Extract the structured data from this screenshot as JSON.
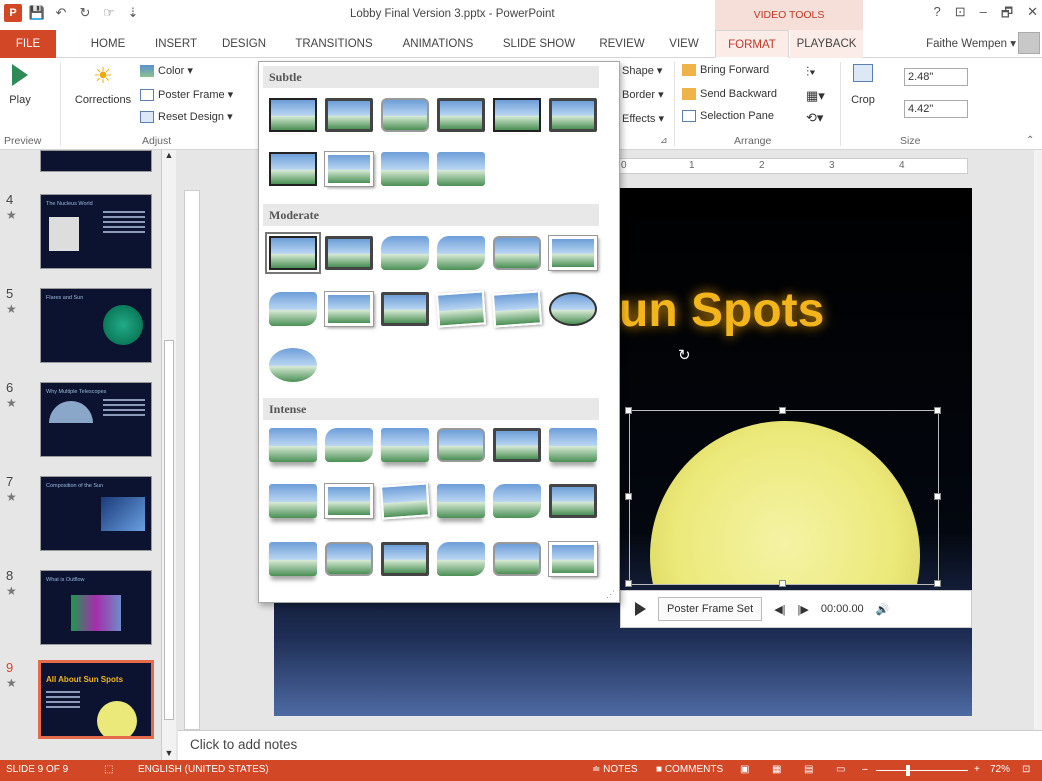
{
  "app": {
    "doc_title": "Lobby Final Version 3.pptx - PowerPoint",
    "context_tab_group": "VIDEO TOOLS",
    "window_controls": [
      "?",
      "⊡",
      "–",
      "🗗",
      "✕"
    ]
  },
  "tabs": {
    "file": "FILE",
    "items": [
      "HOME",
      "INSERT",
      "DESIGN",
      "TRANSITIONS",
      "ANIMATIONS",
      "SLIDE SHOW",
      "REVIEW",
      "VIEW",
      "FORMAT",
      "PLAYBACK"
    ],
    "active": "FORMAT",
    "user": "Faithe Wempen ▾"
  },
  "ribbon": {
    "preview": {
      "play": "Play",
      "label": "Preview"
    },
    "adjust": {
      "corrections": "Corrections",
      "color": "Color ▾",
      "poster_frame": "Poster Frame ▾",
      "reset_design": "Reset Design ▾",
      "label": "Adjust"
    },
    "styles": {
      "shape": "Shape ▾",
      "border": "Border ▾",
      "effects": "Effects ▾"
    },
    "arrange": {
      "bring_forward": "Bring Forward",
      "send_backward": "Send Backward",
      "selection_pane": "Selection Pane",
      "label": "Arrange"
    },
    "size": {
      "crop": "Crop",
      "height": "2.48\"",
      "width": "4.42\"",
      "label": "Size"
    }
  },
  "gallery": {
    "sections": [
      "Subtle",
      "Moderate",
      "Intense"
    ]
  },
  "slides": [
    {
      "num": "4",
      "title": "The Nucleus World"
    },
    {
      "num": "5",
      "title": "Flares and Sun"
    },
    {
      "num": "6",
      "title": "Why Multiple Telescopes"
    },
    {
      "num": "7",
      "title": "Composition of the Sun"
    },
    {
      "num": "8",
      "title": "What is Outflow"
    },
    {
      "num": "9",
      "title": "All About Sun Spots",
      "active": true
    }
  ],
  "slide": {
    "title": "un Spots"
  },
  "video_controls": {
    "poster_frame_set": "Poster Frame Set",
    "time": "00:00.00"
  },
  "ruler": {
    "h_marks": [
      "0",
      "1",
      "2",
      "3",
      "4"
    ]
  },
  "notes": {
    "placeholder": "Click to add notes"
  },
  "status": {
    "slide_of": "SLIDE 9 OF 9",
    "language": "ENGLISH (UNITED STATES)",
    "notes": "≐ NOTES",
    "comments": "■ COMMENTS",
    "zoom": "72%"
  }
}
